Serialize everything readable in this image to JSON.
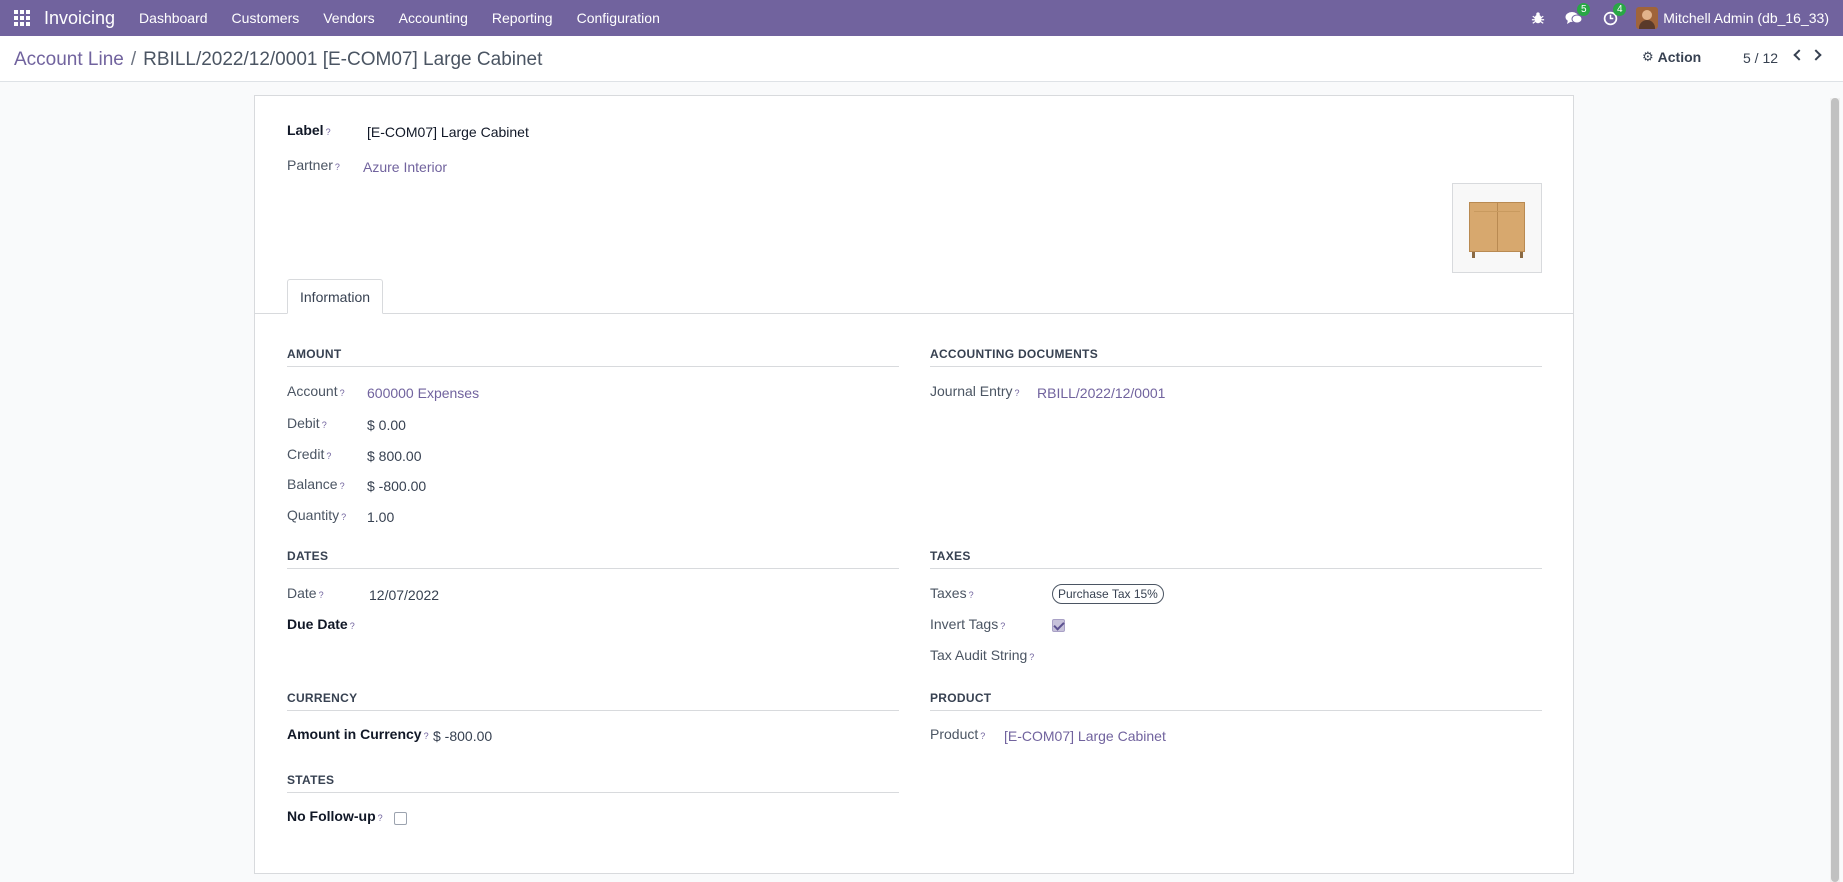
{
  "navbar": {
    "brand": "Invoicing",
    "menu": [
      "Dashboard",
      "Customers",
      "Vendors",
      "Accounting",
      "Reporting",
      "Configuration"
    ],
    "messages_count": "5",
    "activities_count": "4",
    "user_name": "Mitchell Admin (db_16_33)",
    "color": "#71639e"
  },
  "control": {
    "breadcrumb_parent": "Account Line",
    "breadcrumb_sep": "/",
    "breadcrumb_current": "RBILL/2022/12/0001 [E-COM07] Large Cabinet",
    "action_label": "Action",
    "pager": "5 / 12"
  },
  "form": {
    "label": {
      "label": "Label",
      "value": "[E-COM07] Large Cabinet"
    },
    "partner": {
      "label": "Partner",
      "value": "Azure Interior"
    },
    "tab": "Information",
    "sections": {
      "amount": "AMOUNT",
      "accounting_documents": "ACCOUNTING DOCUMENTS",
      "dates": "DATES",
      "taxes": "TAXES",
      "currency": "CURRENCY",
      "product": "PRODUCT",
      "states": "STATES"
    },
    "account": {
      "label": "Account",
      "value": "600000 Expenses"
    },
    "debit": {
      "label": "Debit",
      "value": "$ 0.00"
    },
    "credit": {
      "label": "Credit",
      "value": "$ 800.00"
    },
    "balance": {
      "label": "Balance",
      "value": "$ -800.00"
    },
    "quantity": {
      "label": "Quantity",
      "value": "1.00"
    },
    "journal_entry": {
      "label": "Journal Entry",
      "value": "RBILL/2022/12/0001"
    },
    "date": {
      "label": "Date",
      "value": "12/07/2022"
    },
    "due_date": {
      "label": "Due Date"
    },
    "taxes": {
      "label": "Taxes",
      "tag": "Purchase Tax 15%"
    },
    "invert_tags": {
      "label": "Invert Tags",
      "checked": true
    },
    "tax_audit": {
      "label": "Tax Audit String"
    },
    "amount_currency": {
      "label": "Amount in Currency",
      "value": "$ -800.00"
    },
    "product": {
      "label": "Product",
      "value": "[E-COM07] Large Cabinet"
    },
    "no_followup": {
      "label": "No Follow-up",
      "checked": false
    },
    "help_mark": "?"
  }
}
